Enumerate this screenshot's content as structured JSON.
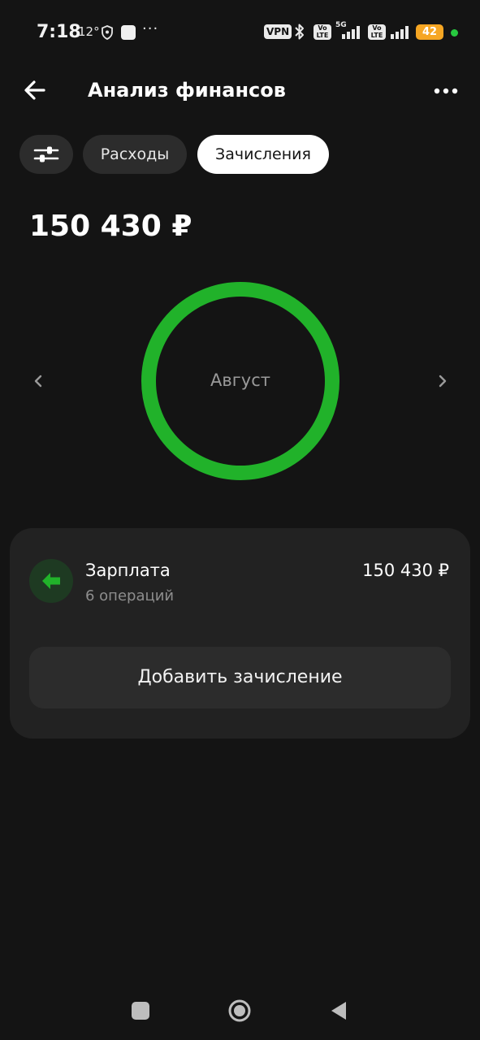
{
  "status_bar": {
    "time": "7:18",
    "temperature": "12°",
    "overflow": "···",
    "vpn_label": "VPN",
    "volte_label_1": "Vo LTE",
    "network_type": "5G",
    "volte_label_2": "Vo LTE",
    "battery_level": "42",
    "battery_color": "#f6a623"
  },
  "header": {
    "title": "Анализ финансов",
    "back_icon": "arrow-left-icon",
    "more_icon": "more-horizontal-icon"
  },
  "filters": {
    "filter_icon": "sliders-icon",
    "tabs": [
      {
        "label": "Расходы",
        "active": false
      },
      {
        "label": "Зачисления",
        "active": true
      }
    ]
  },
  "summary": {
    "total": "150 430 ₽"
  },
  "donut": {
    "center_label": "Август",
    "color": "#21b22a",
    "segments": [
      {
        "category": "Зарплата",
        "share": 1.0
      }
    ]
  },
  "categories": [
    {
      "name": "Зарплата",
      "operations": "6 операций",
      "amount": "150 430 ₽",
      "icon": "arrow-left-icon",
      "icon_color": "#21b22a"
    }
  ],
  "actions": {
    "add_income": "Добавить зачисление"
  },
  "accent_color": "#21b22a"
}
